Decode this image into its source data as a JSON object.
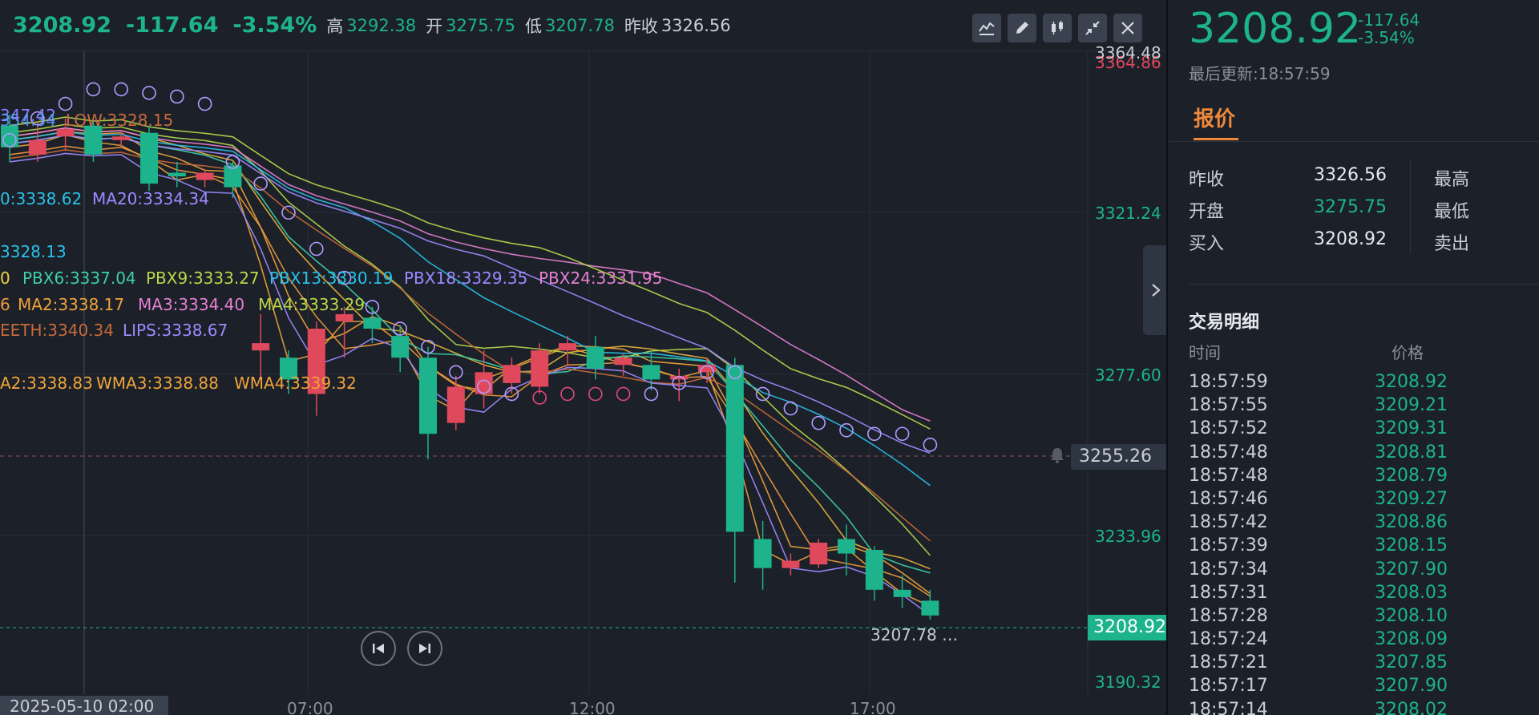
{
  "header": {
    "price": "3208.92",
    "change": "-117.64",
    "change_pct": "-3.54%",
    "high_label": "高",
    "high": "3292.38",
    "open_label": "开",
    "open": "3275.75",
    "low_label": "低",
    "low": "3207.78",
    "prev_close_label": "昨收",
    "prev_close": "3326.56"
  },
  "toolbar": {
    "icons": [
      "line-chart-icon",
      "pencil-icon",
      "candlestick-icon",
      "compress-icon",
      "close-icon"
    ]
  },
  "indicators": {
    "row1_a": "347.42",
    "row1_b": "354.34",
    "row1_low": "LOW:3328.15",
    "row2_a": "0:3338.62",
    "row2_ma20": "MA20:3334.34",
    "row3": "3328.13",
    "row4_a": "0",
    "row4_pbx6": "PBX6:3337.04",
    "row4_pbx9": "PBX9:3333.27",
    "row4_pbx13": "PBX13:3330.19",
    "row4_pbx18": "PBX18:3329.35",
    "row4_pbx24": "PBX24:3331.95",
    "row5_a": "6",
    "row5_ma2": "MA2:3338.17",
    "row5_ma3": "MA3:3334.40",
    "row5_ma4": "MA4:3333.29",
    "row6_teeth": "EETH:3340.34",
    "row6_lips": "LIPS:3338.67",
    "row7_a": "A2:3338.83",
    "row7_wma3": "WMA3:3338.88",
    "row7_wma4": "WMA4:3339.32"
  },
  "price_axis": {
    "top_a": "3364.48",
    "top_b": "3364.86",
    "ticks": [
      "3321.24",
      "3277.60",
      "3233.96",
      "3190.32"
    ]
  },
  "time_axis": {
    "date_tag": "2025-05-10 02:00",
    "ticks": [
      "07:00",
      "12:00",
      "17:00"
    ]
  },
  "alert_price": "3255.26",
  "current_price_tag": "3208.92",
  "low_marker": "3207.78",
  "low_marker_suffix": "…",
  "colors": {
    "up": "#e0495c",
    "down": "#1db38c",
    "accent": "#f08a3a",
    "background": "#1b2029"
  },
  "chart_data": {
    "type": "candlestick",
    "ylim": [
      3190.32,
      3364.48
    ],
    "candles": [
      {
        "o": 3344,
        "h": 3347,
        "c": 3338,
        "l": 3334
      },
      {
        "o": 3336,
        "h": 3345,
        "c": 3340,
        "l": 3334
      },
      {
        "o": 3341,
        "h": 3346,
        "c": 3343,
        "l": 3337
      },
      {
        "o": 3344,
        "h": 3346,
        "c": 3336,
        "l": 3334
      },
      {
        "o": 3340,
        "h": 3342,
        "c": 3341,
        "l": 3338
      },
      {
        "o": 3342,
        "h": 3344,
        "c": 3328,
        "l": 3326
      },
      {
        "o": 3331,
        "h": 3334,
        "c": 3330,
        "l": 3327
      },
      {
        "o": 3329,
        "h": 3332,
        "c": 3331,
        "l": 3327
      },
      {
        "o": 3333,
        "h": 3334,
        "c": 3327,
        "l": 3324
      },
      {
        "o": 3282,
        "h": 3292,
        "c": 3284,
        "l": 3274
      },
      {
        "o": 3280,
        "h": 3282,
        "c": 3274,
        "l": 3270
      },
      {
        "o": 3270,
        "h": 3290,
        "c": 3288,
        "l": 3264
      },
      {
        "o": 3290,
        "h": 3294,
        "c": 3292,
        "l": 3280
      },
      {
        "o": 3291,
        "h": 3294,
        "c": 3288,
        "l": 3284
      },
      {
        "o": 3286,
        "h": 3289,
        "c": 3280,
        "l": 3276
      },
      {
        "o": 3280,
        "h": 3283,
        "c": 3259,
        "l": 3252
      },
      {
        "o": 3262,
        "h": 3275,
        "c": 3272,
        "l": 3260
      },
      {
        "o": 3270,
        "h": 3282,
        "c": 3276,
        "l": 3266
      },
      {
        "o": 3273,
        "h": 3280,
        "c": 3278,
        "l": 3270
      },
      {
        "o": 3272,
        "h": 3284,
        "c": 3282,
        "l": 3270
      },
      {
        "o": 3282,
        "h": 3286,
        "c": 3284,
        "l": 3278
      },
      {
        "o": 3283,
        "h": 3286,
        "c": 3277,
        "l": 3274
      },
      {
        "o": 3278,
        "h": 3281,
        "c": 3280,
        "l": 3275
      },
      {
        "o": 3278,
        "h": 3282,
        "c": 3274,
        "l": 3271
      },
      {
        "o": 3274,
        "h": 3277,
        "c": 3275,
        "l": 3268
      },
      {
        "o": 3276,
        "h": 3280,
        "c": 3278,
        "l": 3273
      },
      {
        "o": 3278,
        "h": 3280,
        "c": 3232,
        "l": 3218
      },
      {
        "o": 3230,
        "h": 3235,
        "c": 3222,
        "l": 3216
      },
      {
        "o": 3222,
        "h": 3226,
        "c": 3224,
        "l": 3220
      },
      {
        "o": 3223,
        "h": 3230,
        "c": 3229,
        "l": 3222
      },
      {
        "o": 3230,
        "h": 3234,
        "c": 3226,
        "l": 3220
      },
      {
        "o": 3227,
        "h": 3228,
        "c": 3216,
        "l": 3213
      },
      {
        "o": 3216,
        "h": 3220,
        "c": 3214,
        "l": 3211
      },
      {
        "o": 3213,
        "h": 3216,
        "c": 3208.92,
        "l": 3207.78
      }
    ],
    "sar_points": [
      3340,
      3346,
      3350,
      3354,
      3354,
      3353,
      3352,
      3350,
      3334,
      3328,
      3320,
      3310,
      3302,
      3294,
      3288,
      3283,
      3276,
      3272,
      3270,
      3269,
      3270,
      3270,
      3270,
      3270,
      3273,
      3276,
      3276,
      3270,
      3266,
      3262,
      3260,
      3259,
      3259,
      3256
    ]
  },
  "side": {
    "price": "3208.92",
    "change": "-117.64",
    "change_pct": "-3.54%",
    "update_label": "最后更新:18:57:59",
    "tab_label": "报价",
    "quote": {
      "prev_close_label": "昨收",
      "prev_close": "3326.56",
      "open_label": "开盘",
      "open": "3275.75",
      "bid_label": "买入",
      "bid": "3208.92",
      "high_label": "最高",
      "low_label": "最低",
      "ask_label": "卖出"
    },
    "detail_title": "交易明细",
    "col_time": "时间",
    "col_price": "价格",
    "trades": [
      {
        "time": "18:57:59",
        "price": "3208.92"
      },
      {
        "time": "18:57:55",
        "price": "3209.21"
      },
      {
        "time": "18:57:52",
        "price": "3209.31"
      },
      {
        "time": "18:57:48",
        "price": "3208.81"
      },
      {
        "time": "18:57:48",
        "price": "3208.79"
      },
      {
        "time": "18:57:46",
        "price": "3209.27"
      },
      {
        "time": "18:57:42",
        "price": "3208.86"
      },
      {
        "time": "18:57:39",
        "price": "3208.15"
      },
      {
        "time": "18:57:34",
        "price": "3207.90"
      },
      {
        "time": "18:57:31",
        "price": "3208.03"
      },
      {
        "time": "18:57:28",
        "price": "3208.10"
      },
      {
        "time": "18:57:24",
        "price": "3208.09"
      },
      {
        "time": "18:57:21",
        "price": "3207.85"
      },
      {
        "time": "18:57:17",
        "price": "3207.90"
      },
      {
        "time": "18:57:14",
        "price": "3208.02"
      }
    ]
  }
}
